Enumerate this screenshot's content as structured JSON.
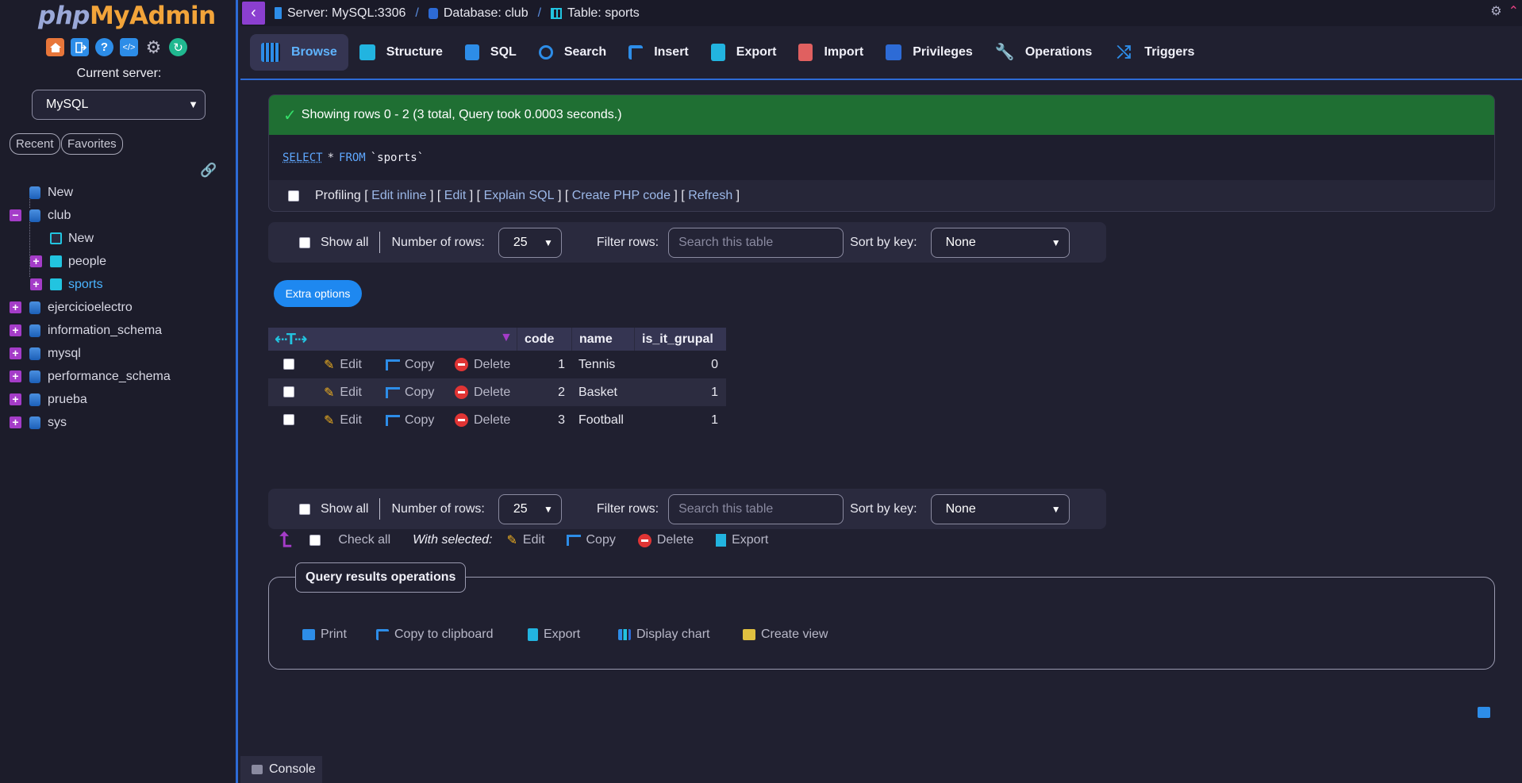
{
  "sidebar": {
    "logo_php": "php",
    "logo_myadmin": "MyAdmin",
    "current_server_label": "Current server:",
    "server_select": "MySQL",
    "recent": "Recent",
    "favorites": "Favorites",
    "tree": {
      "new_top": "New",
      "club": "club",
      "club_new": "New",
      "people": "people",
      "sports": "sports",
      "ejercicioelectro": "ejercicioelectro",
      "information_schema": "information_schema",
      "mysql": "mysql",
      "performance_schema": "performance_schema",
      "prueba": "prueba",
      "sys": "sys"
    }
  },
  "breadcrumb": {
    "server": "Server: MySQL:3306",
    "database": "Database: club",
    "table": "Table: sports"
  },
  "tabs": {
    "browse": "Browse",
    "structure": "Structure",
    "sql": "SQL",
    "search": "Search",
    "insert": "Insert",
    "export": "Export",
    "import": "Import",
    "privileges": "Privileges",
    "operations": "Operations",
    "triggers": "Triggers"
  },
  "result": {
    "message": "Showing rows 0 - 2 (3 total, Query took 0.0003 seconds.)",
    "sql_select": "SELECT",
    "sql_star": "*",
    "sql_from": "FROM",
    "sql_table": "`sports`",
    "profiling": "Profiling",
    "edit_inline": "Edit inline",
    "edit": "Edit",
    "explain_sql": "Explain SQL",
    "create_php": "Create PHP code",
    "refresh": "Refresh"
  },
  "nav": {
    "show_all": "Show all",
    "number_of_rows": "Number of rows:",
    "rows_value": "25",
    "filter_rows": "Filter rows:",
    "search_placeholder": "Search this table",
    "sort_by_key": "Sort by key:",
    "sort_value": "None"
  },
  "extra_options": "Extra options",
  "table": {
    "columns": [
      "code",
      "name",
      "is_it_grupal"
    ],
    "actions": {
      "edit": "Edit",
      "copy": "Copy",
      "delete": "Delete"
    },
    "rows": [
      {
        "code": "1",
        "name": "Tennis",
        "is_it_grupal": "0"
      },
      {
        "code": "2",
        "name": "Basket",
        "is_it_grupal": "1"
      },
      {
        "code": "3",
        "name": "Football",
        "is_it_grupal": "1"
      }
    ]
  },
  "with_selected": {
    "check_all": "Check all",
    "label": "With selected:",
    "edit": "Edit",
    "copy": "Copy",
    "delete": "Delete",
    "export": "Export"
  },
  "query_ops": {
    "legend": "Query results operations",
    "print": "Print",
    "copy_clipboard": "Copy to clipboard",
    "export": "Export",
    "display_chart": "Display chart",
    "create_view": "Create view"
  },
  "console": "Console",
  "colors": {
    "accent": "#2d6bd6",
    "success": "#1f6f33",
    "active_tab_text": "#5fb4ff",
    "expander": "#a43cc8"
  }
}
